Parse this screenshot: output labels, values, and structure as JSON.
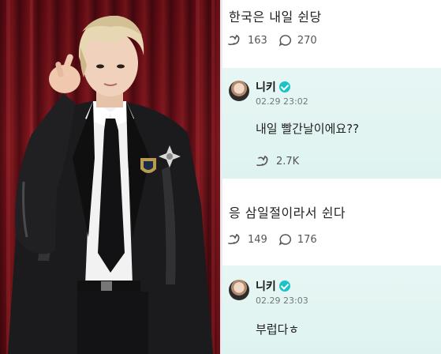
{
  "chat": {
    "messages": [
      {
        "type": "fan",
        "text": "한국은 내일 쉰당",
        "likes": "163",
        "comments": "270"
      },
      {
        "type": "artist",
        "name": "니키",
        "time": "02.29 23:02",
        "text": "내일 빨간날이에요??",
        "likes": "2.7K"
      },
      {
        "type": "fan",
        "text": "응 삼일절이라서 쉰다",
        "likes": "149",
        "comments": "176"
      },
      {
        "type": "artist",
        "name": "니키",
        "time": "02.29 23:03",
        "text": "부럽다ㅎ"
      }
    ],
    "colors": {
      "artist_bg": "#e3f5f2",
      "verified": "#19c3c7",
      "text": "#222222"
    },
    "icons": [
      "like-icon",
      "comment-icon",
      "verified-badge-icon"
    ]
  },
  "photo": {
    "subject": "person in black leather jacket making finger heart in front of red curtain"
  }
}
